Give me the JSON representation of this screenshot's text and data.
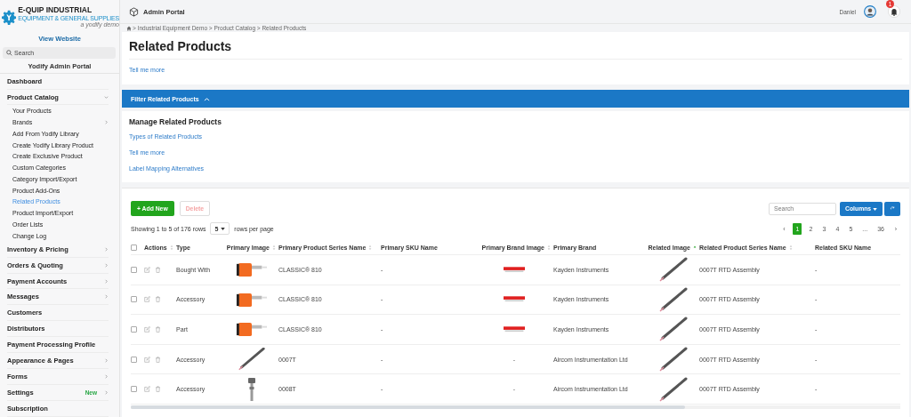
{
  "brand": {
    "name": "E-QUIP INDUSTRIAL",
    "tagline": "EQUIPMENT & GENERAL SUPPLIES",
    "note": "a yodify demo"
  },
  "sidebar": {
    "view_website": "View Website",
    "search": {
      "placeholder": "Search"
    },
    "portal_title": "Yodify Admin Portal",
    "items": [
      {
        "label": "Dashboard",
        "has_arrow": false
      },
      {
        "label": "Product Catalog",
        "has_arrow": true,
        "expanded": true,
        "children": [
          {
            "label": "Your Products",
            "selected": false,
            "has_arrow": false
          },
          {
            "label": "Brands",
            "selected": false,
            "has_arrow": true
          },
          {
            "label": "Add From Yodify Library",
            "selected": false,
            "has_arrow": false
          },
          {
            "label": "Create Yodify Library Product",
            "selected": false,
            "has_arrow": false
          },
          {
            "label": "Create Exclusive Product",
            "selected": false,
            "has_arrow": false
          },
          {
            "label": "Custom Categories",
            "selected": false,
            "has_arrow": false
          },
          {
            "label": "Category Import/Export",
            "selected": false,
            "has_arrow": false
          },
          {
            "label": "Product Add-Ons",
            "selected": false,
            "has_arrow": false
          },
          {
            "label": "Related Products",
            "selected": true,
            "has_arrow": false
          },
          {
            "label": "Product Import/Export",
            "selected": false,
            "has_arrow": false
          },
          {
            "label": "Order Lists",
            "selected": false,
            "has_arrow": false
          },
          {
            "label": "Change Log",
            "selected": false,
            "has_arrow": false
          }
        ]
      },
      {
        "label": "Inventory & Pricing",
        "has_arrow": true,
        "expanded": false
      },
      {
        "label": "Orders & Quoting",
        "has_arrow": true,
        "expanded": false
      },
      {
        "label": "Payment Accounts",
        "has_arrow": true,
        "expanded": false
      },
      {
        "label": "Messages",
        "has_arrow": true,
        "expanded": false
      },
      {
        "label": "Customers",
        "has_arrow": false
      },
      {
        "label": "Distributors",
        "has_arrow": false
      },
      {
        "label": "Payment Processing Profile",
        "has_arrow": false
      },
      {
        "label": "Appearance & Pages",
        "has_arrow": true,
        "expanded": false
      },
      {
        "label": "Forms",
        "has_arrow": true,
        "expanded": false
      },
      {
        "label": "Settings",
        "has_arrow": true,
        "expanded": false,
        "badge": "New"
      },
      {
        "label": "Subscription",
        "has_arrow": false
      }
    ]
  },
  "topbar": {
    "title": "Admin Portal",
    "user": "Daniel",
    "notifications": "1"
  },
  "breadcrumb": {
    "separator": ">",
    "items": [
      "Industrial Equipment Demo",
      "Product Catalog",
      "Related Products"
    ]
  },
  "page": {
    "title": "Related Products",
    "link": "Tell me more"
  },
  "filter_bar": {
    "label": "Filter Related Products",
    "expanded": true
  },
  "manage": {
    "title": "Manage Related Products",
    "links": [
      "Types of Related Products",
      "Tell me more",
      "Label Mapping Alternatives"
    ]
  },
  "toolbar": {
    "add": "+ Add New",
    "delete": "Delete",
    "delete_disabled": true,
    "search": {
      "placeholder": "Search"
    },
    "columns": "Columns"
  },
  "summary": {
    "showing": "Showing 1 to 5 of 176 rows",
    "page_size": "5",
    "per_page": "rows per page"
  },
  "pagination": [
    {
      "label": "‹",
      "selected": false
    },
    {
      "label": "1",
      "selected": true
    },
    {
      "label": "2",
      "selected": false
    },
    {
      "label": "3",
      "selected": false
    },
    {
      "label": "4",
      "selected": false
    },
    {
      "label": "5",
      "selected": false
    },
    {
      "label": "...",
      "selected": false
    },
    {
      "label": "36",
      "selected": false
    },
    {
      "label": "›",
      "selected": false
    }
  ],
  "table": {
    "all_checked": false,
    "columns": [
      {
        "label": "Actions",
        "sortable": true,
        "sorted": false
      },
      {
        "label": "Type",
        "sortable": false,
        "sorted": false
      },
      {
        "label": "Primary Image",
        "sortable": true,
        "sorted": false
      },
      {
        "label": "Primary Product Series Name",
        "sortable": true,
        "sorted": false
      },
      {
        "label": "Primary SKU Name",
        "sortable": false,
        "sorted": false
      },
      {
        "label": "Primary Brand Image",
        "sortable": true,
        "sorted": false
      },
      {
        "label": "Primary Brand",
        "sortable": false,
        "sorted": false
      },
      {
        "label": "Related Image",
        "sortable": true,
        "sorted": true
      },
      {
        "label": "Related Product Series Name",
        "sortable": true,
        "sorted": false
      },
      {
        "label": "Related SKU Name",
        "sortable": false,
        "sorted": false
      }
    ],
    "rows": [
      {
        "checked": false,
        "type": "Bought With",
        "series": "CLASSIC® 810",
        "sku": "-",
        "brand_image": {
          "kind": "logo"
        },
        "brand": "Kayden Instruments",
        "related_series": "0007T RTD Assembly",
        "related_sku": "-"
      },
      {
        "checked": false,
        "type": "Accessory",
        "series": "CLASSIC® 810",
        "sku": "-",
        "brand_image": {
          "kind": "logo"
        },
        "brand": "Kayden Instruments",
        "related_series": "0007T RTD Assembly",
        "related_sku": "-"
      },
      {
        "checked": false,
        "type": "Part",
        "series": "CLASSIC® 810",
        "sku": "-",
        "brand_image": {
          "kind": "logo"
        },
        "brand": "Kayden Instruments",
        "related_series": "0007T RTD Assembly",
        "related_sku": "-"
      },
      {
        "checked": false,
        "type": "Accessory",
        "series": "0007T",
        "sku": "-",
        "brand_image": {
          "kind": "text",
          "text": "-"
        },
        "brand": "Aircom Instrumentation Ltd",
        "related_series": "0007T RTD Assembly",
        "related_sku": "-"
      },
      {
        "checked": false,
        "type": "Accessory",
        "series": "0008T",
        "sku": "-",
        "brand_image": {
          "kind": "text",
          "text": "-"
        },
        "brand": "Aircom Instrumentation Ltd",
        "related_series": "0007T RTD Assembly",
        "related_sku": "-"
      }
    ]
  }
}
